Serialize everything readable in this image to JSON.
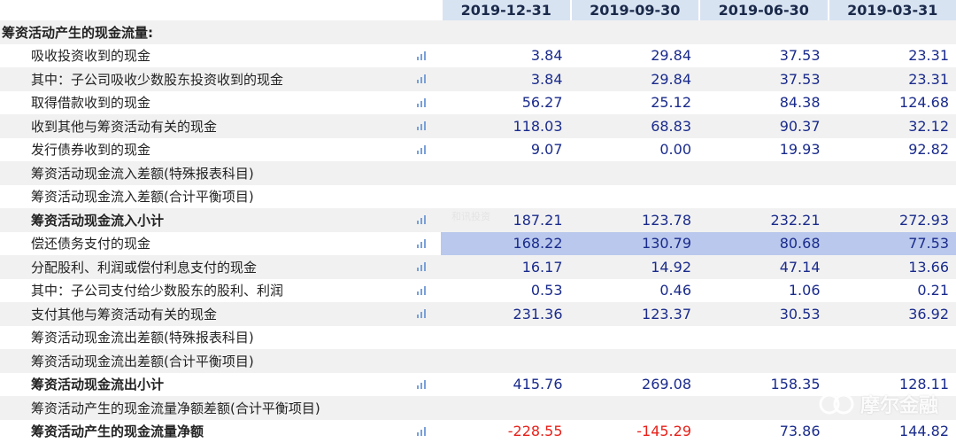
{
  "headers": [
    "2019-12-31",
    "2019-09-30",
    "2019-06-30",
    "2019-03-31"
  ],
  "section_title": "筹资活动产生的现金流量:",
  "rows": [
    {
      "label": "吸收投资收到的现金",
      "bold": false,
      "icon": true,
      "values": [
        "3.84",
        "29.84",
        "37.53",
        "23.31"
      ]
    },
    {
      "label": "其中：子公司吸收少数股东投资收到的现金",
      "bold": false,
      "icon": true,
      "values": [
        "3.84",
        "29.84",
        "37.53",
        "23.31"
      ]
    },
    {
      "label": "取得借款收到的现金",
      "bold": false,
      "icon": true,
      "values": [
        "56.27",
        "25.12",
        "84.38",
        "124.68"
      ]
    },
    {
      "label": "收到其他与筹资活动有关的现金",
      "bold": false,
      "icon": true,
      "values": [
        "118.03",
        "68.83",
        "90.37",
        "32.12"
      ]
    },
    {
      "label": "发行债券收到的现金",
      "bold": false,
      "icon": true,
      "values": [
        "9.07",
        "0.00",
        "19.93",
        "92.82"
      ]
    },
    {
      "label": "筹资活动现金流入差额(特殊报表科目)",
      "bold": false,
      "icon": false,
      "values": [
        "",
        "",
        "",
        ""
      ]
    },
    {
      "label": "筹资活动现金流入差额(合计平衡项目)",
      "bold": false,
      "icon": false,
      "values": [
        "",
        "",
        "",
        ""
      ]
    },
    {
      "label": "筹资活动现金流入小计",
      "bold": true,
      "icon": true,
      "values": [
        "187.21",
        "123.78",
        "232.21",
        "272.93"
      ]
    },
    {
      "label": "偿还债务支付的现金",
      "bold": false,
      "icon": true,
      "highlight": true,
      "values": [
        "168.22",
        "130.79",
        "80.68",
        "77.53"
      ]
    },
    {
      "label": "分配股利、利润或偿付利息支付的现金",
      "bold": false,
      "icon": true,
      "values": [
        "16.17",
        "14.92",
        "47.14",
        "13.66"
      ]
    },
    {
      "label": "其中：子公司支付给少数股东的股利、利润",
      "bold": false,
      "icon": true,
      "values": [
        "0.53",
        "0.46",
        "1.06",
        "0.21"
      ]
    },
    {
      "label": "支付其他与筹资活动有关的现金",
      "bold": false,
      "icon": true,
      "values": [
        "231.36",
        "123.37",
        "30.53",
        "36.92"
      ]
    },
    {
      "label": "筹资活动现金流出差额(特殊报表科目)",
      "bold": false,
      "icon": false,
      "values": [
        "",
        "",
        "",
        ""
      ]
    },
    {
      "label": "筹资活动现金流出差额(合计平衡项目)",
      "bold": false,
      "icon": false,
      "values": [
        "",
        "",
        "",
        ""
      ]
    },
    {
      "label": "筹资活动现金流出小计",
      "bold": true,
      "icon": true,
      "values": [
        "415.76",
        "269.08",
        "158.35",
        "128.11"
      ]
    },
    {
      "label": "筹资活动产生的现金流量净额差额(合计平衡项目)",
      "bold": false,
      "icon": false,
      "values": [
        "",
        "",
        "",
        ""
      ]
    },
    {
      "label": "筹资活动产生的现金流量净额",
      "bold": true,
      "icon": true,
      "values": [
        "-228.55",
        "-145.29",
        "73.86",
        "144.82"
      ]
    }
  ],
  "icon_name": "bar-chart-icon",
  "colors": {
    "value": "#1a2b8c",
    "negative": "#e8211a",
    "header_bg": "#d8e3f2",
    "highlight": "#b9c8ec",
    "icon": "#7aa0d8"
  },
  "watermark_small": "和讯投资",
  "watermark": "摩尔金融"
}
